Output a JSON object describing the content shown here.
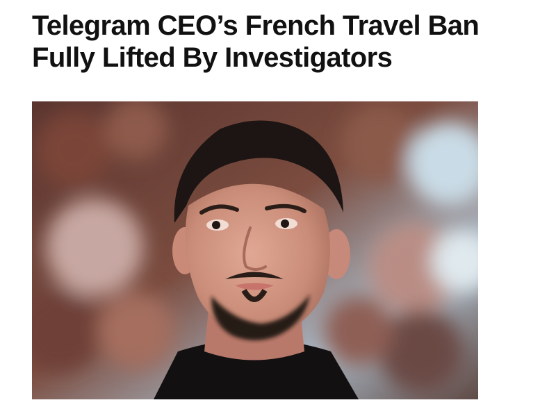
{
  "article": {
    "headline_line1": "Telegram CEO’s French Travel Ban",
    "headline_line2": "Fully Lifted By Investigators",
    "photo": {
      "subject": "portrait-photo",
      "colors": {
        "background_dark": "#4a2b26",
        "background_warm": "#8b5a4a",
        "background_cool": "#c9dbe6",
        "hair": "#1d1513",
        "skin": "#d49a84",
        "shirt": "#121011"
      }
    }
  }
}
